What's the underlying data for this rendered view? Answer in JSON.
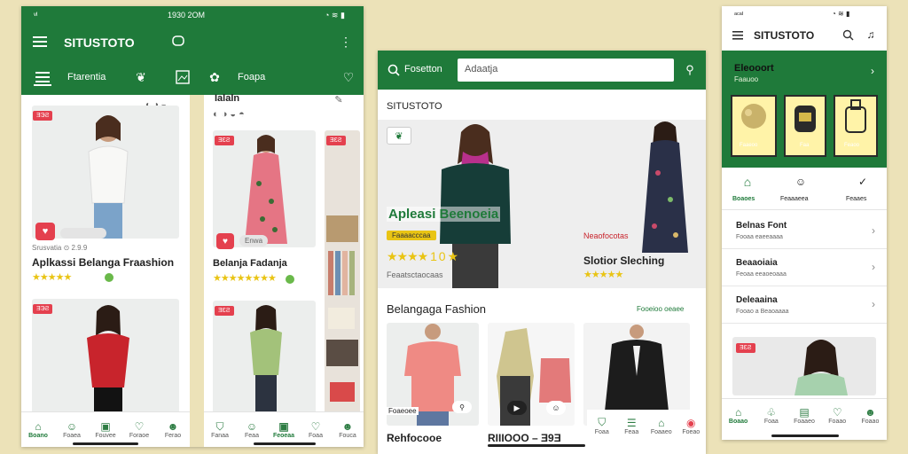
{
  "colors": {
    "brand_green": "#1f7a3a",
    "badge_red": "#e4404e",
    "star_yellow": "#e9c414",
    "background": "#ece2b8"
  },
  "panelA": {
    "status_left": "ᵛᴵ",
    "status_time": "1930 2OM",
    "status_right": "◔ ≋ ▮",
    "title": "SITUSTOTO",
    "tabs": [
      {
        "label": "",
        "icon": "list-icon"
      },
      {
        "label": "Ftarentia",
        "icon": ""
      },
      {
        "label": "",
        "icon": "leaf-icon"
      },
      {
        "label": "",
        "icon": "photo-icon"
      },
      {
        "label": "",
        "icon": "heart-icon"
      },
      {
        "label": "Foapa",
        "icon": ""
      }
    ],
    "col1": {
      "card1_badge": "ƎЭƧ",
      "card1_meta": "Srusvatia ⊙ 2.9.9",
      "card1_title": "Aplkassi Belanga Fraashion",
      "card1_stars": "★★★★★",
      "card2_badge": "ƎЭƧ"
    },
    "col2": {
      "header": "Ialaln",
      "header_icons": "◐ ◑ ◒ ◓",
      "card1_badge": "ƎƐƧ",
      "card1_chip": "Enwa",
      "card1_title": "Belanja Fadanja",
      "card1_stars": "★★★★★★★★",
      "card2_badge": "ƎƐƧ"
    },
    "nav_left": [
      "Boano",
      "Foaea",
      "Fouvee",
      "Foraoe",
      "Ferao"
    ],
    "nav_right": [
      "Fanaa",
      "Feaa",
      "Feoeaa",
      "Foaa",
      "Fouca"
    ]
  },
  "panelB": {
    "search_label": "Fosetton",
    "search_value": "Adaatja",
    "brand": "SITUSTOTO",
    "hero_overlay": "Apleasi Beenoeia",
    "hero_pill": "Faaaacccaa",
    "hero_stars": "★★★★ 1 0 ★",
    "hero_caption": "Feaatsctaocaas",
    "promo_label": "Neaofocotas",
    "promo_title": "Slotior Sleching",
    "promo_stars": "★★★★★",
    "section_title": "Belangaga Fashion",
    "section_link": "Fooeioo oeaee",
    "chip_left": "Foaeoee",
    "price_left": "Rehfocooe",
    "price_mid": "RIIIOOO – Ǝ9Ǝ",
    "nav": [
      "Foaa",
      "Feaa",
      "Foaaeo",
      "Foeao"
    ]
  },
  "panelC": {
    "status_left": "ᵃᶜᵃᴵ",
    "status_right": "◔ ≋ ▮",
    "title": "SITUSTOTO",
    "banner_title": "Eleooort",
    "banner_sub": "Faauoo",
    "banner_items": [
      "Faaeoo",
      "Faa",
      "Feaoo"
    ],
    "cats": [
      "Boaoes",
      "Feaaaeea",
      "Feaaes"
    ],
    "list": [
      {
        "title": "Belnas Font",
        "sub": "Fooaa eaeeaaaa"
      },
      {
        "title": "Beaaoiaia",
        "sub": "Feoaa eeaoeoaaa"
      },
      {
        "title": "Deleaaina",
        "sub": "Fooao a Beaoaaaa"
      }
    ],
    "badge": "ƎƐƧ",
    "nav": [
      "Boaao",
      "Foaa",
      "Foaaeo",
      "Foaao",
      "Foaao"
    ]
  }
}
